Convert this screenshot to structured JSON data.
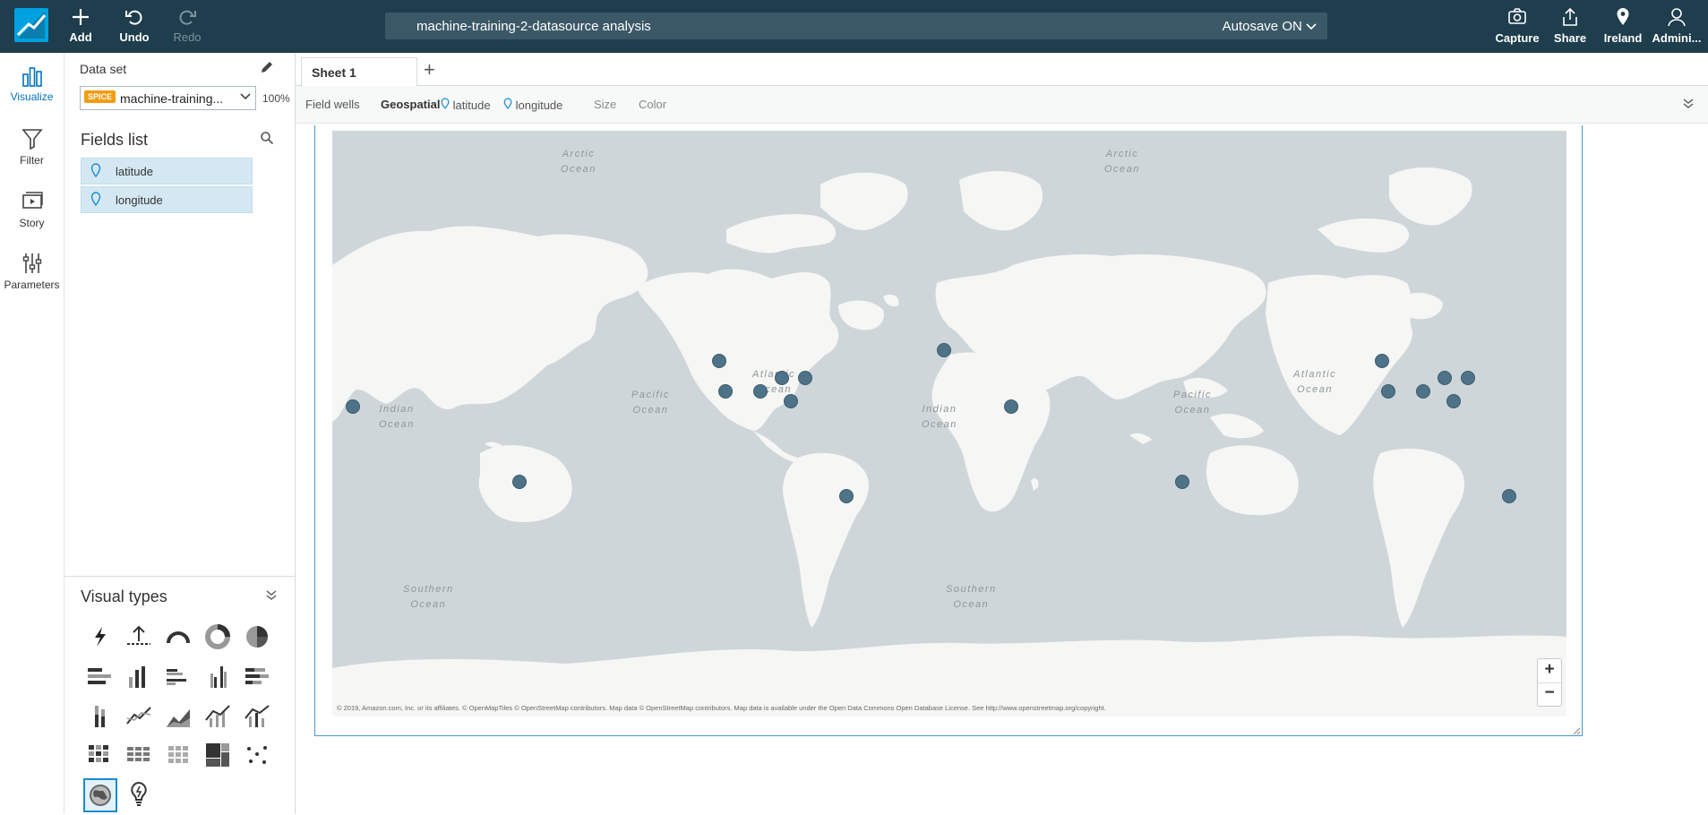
{
  "topbar": {
    "add_label": "Add",
    "undo_label": "Undo",
    "redo_label": "Redo",
    "analysis_title": "machine-training-2-datasource analysis",
    "autosave_label": "Autosave ON",
    "capture_label": "Capture",
    "share_label": "Share",
    "region_label": "Ireland",
    "user_label": "Admini..."
  },
  "rail": {
    "visualize": "Visualize",
    "filter": "Filter",
    "story": "Story",
    "parameters": "Parameters"
  },
  "panel": {
    "dataset_label": "Data set",
    "spice_badge": "SPICE",
    "dataset_name": "machine-training...",
    "dataset_percent": "100%",
    "fields_title": "Fields list",
    "fields": [
      "latitude",
      "longitude"
    ],
    "visual_types_title": "Visual types"
  },
  "sheet": {
    "tab_label": "Sheet 1"
  },
  "wells": {
    "label": "Field wells",
    "geo_label": "Geospatial",
    "lat": "latitude",
    "lon": "longitude",
    "size": "Size",
    "color": "Color"
  },
  "map": {
    "attribution": "© 2019, Amazon.com, Inc. or its affiliates. © OpenMapTiles © OpenStreetMap contributors. Map data © OpenStreetMap contributors. Map data is available under the Open Data Commons Open Database License. See http://www.openstreetmap.org/copyright.",
    "zoom_in": "+",
    "zoom_out": "−",
    "oceans": {
      "arctic1": "Arctic",
      "arctic2": "Ocean",
      "arctic_b1": "Arctic",
      "arctic_b2": "Ocean",
      "atl1": "Atlantic",
      "atl2": "Ocean",
      "atl_b1": "Atlantic",
      "atl_b2": "Ocean",
      "pac1": "Pacific",
      "pac2": "Ocean",
      "pac_b1": "Pacific",
      "pac_b2": "Ocean",
      "ind1": "Indian",
      "ind2": "Ocean",
      "ind_b1": "Indian",
      "ind_b2": "Ocean",
      "so1": "Southern",
      "so2": "Ocean",
      "so_b1": "Southern",
      "so_b2": "Ocean"
    }
  },
  "colors": {
    "topbar": "#1e3d4d",
    "accent": "#00a1e0",
    "point": "#4e7388",
    "field_bg": "#d4e8f3",
    "spice": "#f39c12"
  }
}
